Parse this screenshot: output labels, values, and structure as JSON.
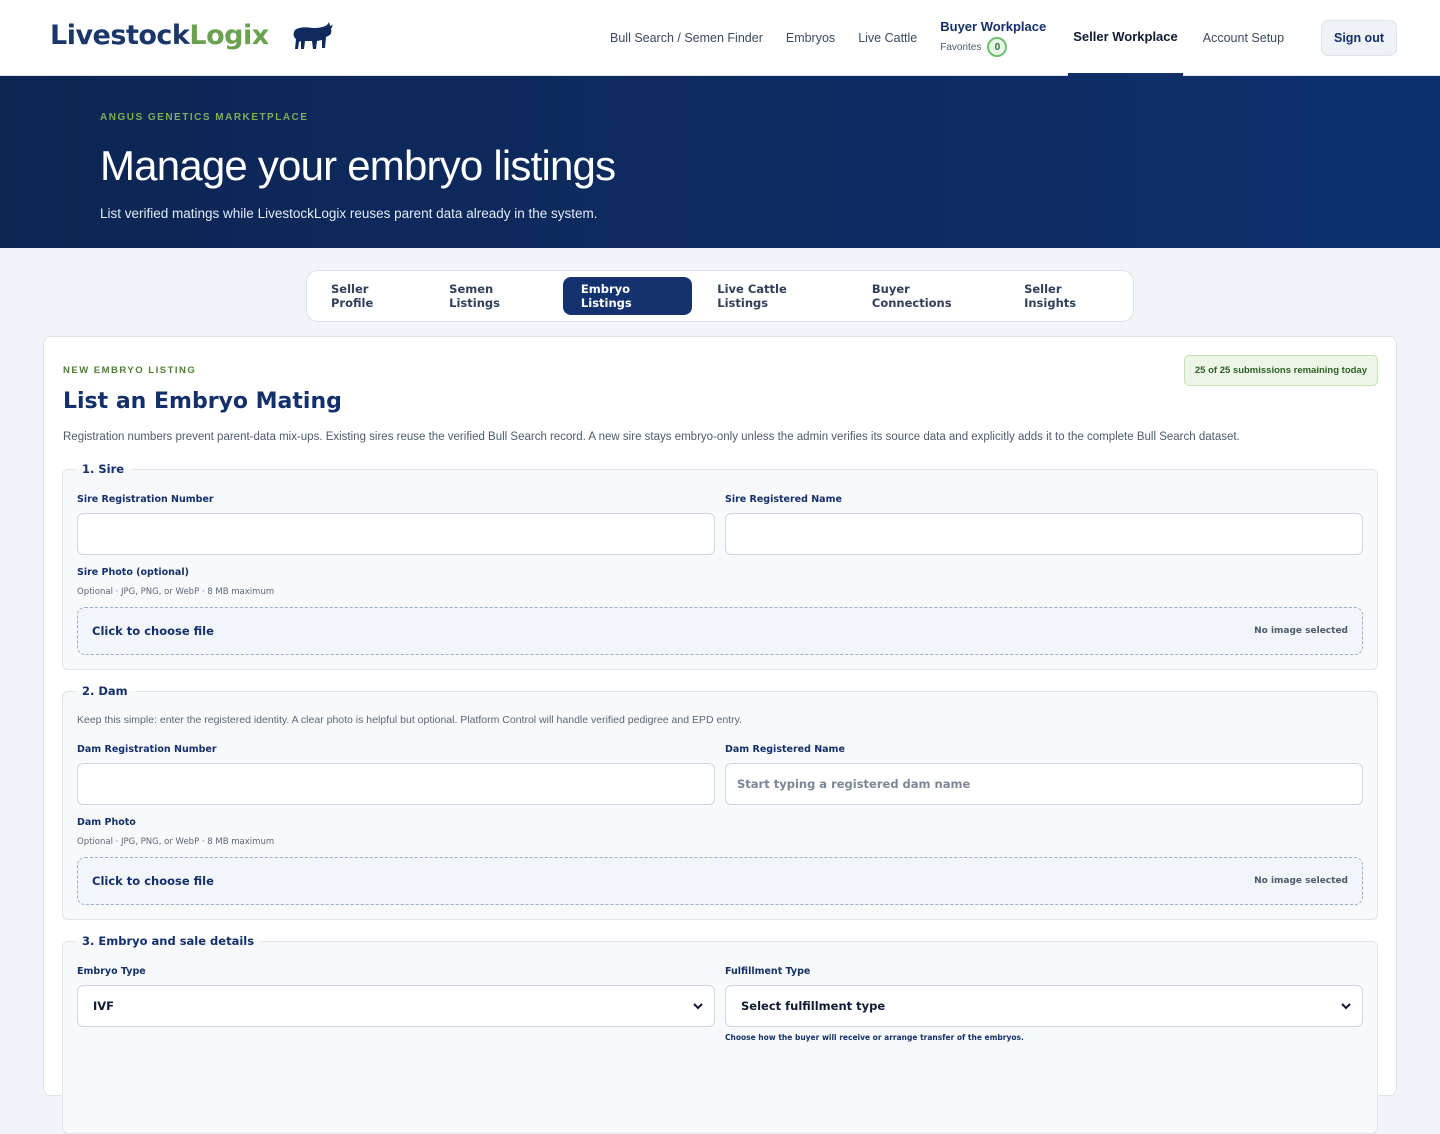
{
  "brand": {
    "name_main": "Livestock",
    "name_accent": "Logix"
  },
  "colors": {
    "navy": "#14306a",
    "accent_green": "#6aa24f",
    "hero_bg": "#0c2553"
  },
  "nav": {
    "items": [
      "Bull Search / Semen Finder",
      "Embryos",
      "Live Cattle"
    ],
    "buyer_workplace": "Buyer Workplace",
    "favorites_label": "Favorites",
    "favorites_count": "0",
    "seller_workplace": "Seller Workplace",
    "account_setup": "Account Setup",
    "sign_out": "Sign out"
  },
  "hero": {
    "kicker": "ANGUS GENETICS MARKETPLACE",
    "title": "Manage your embryo listings",
    "subtitle": "List verified matings while LivestockLogix reuses parent data already in the system."
  },
  "tabs": [
    {
      "label": "Seller Profile",
      "active": false
    },
    {
      "label": "Semen Listings",
      "active": false
    },
    {
      "label": "Embryo Listings",
      "active": true
    },
    {
      "label": "Live Cattle Listings",
      "active": false
    },
    {
      "label": "Buyer Connections",
      "active": false
    },
    {
      "label": "Seller Insights",
      "active": false
    }
  ],
  "form": {
    "kicker": "NEW EMBRYO LISTING",
    "title": "List an Embryo Mating",
    "submissions": "25 of 25 submissions remaining today",
    "intro": "Registration numbers prevent parent-data mix-ups. Existing sires reuse the verified Bull Search record. A new sire stays embryo-only unless the admin verifies its source data and explicitly adds it to the complete Bull Search dataset.",
    "sire": {
      "legend": "1. Sire",
      "reg_label": "Sire Registration Number",
      "reg_value": "",
      "name_label": "Sire Registered Name",
      "name_value": "",
      "photo_label": "Sire Photo (optional)",
      "photo_hint": "Optional · JPG, PNG, or WebP · 8 MB maximum",
      "choose": "Click to choose file",
      "none": "No image selected"
    },
    "dam": {
      "legend": "2. Dam",
      "note": "Keep this simple: enter the registered identity. A clear photo is helpful but optional. Platform Control will handle verified pedigree and EPD entry.",
      "reg_label": "Dam Registration Number",
      "reg_value": "",
      "name_label": "Dam Registered Name",
      "name_placeholder": "Start typing a registered dam name",
      "photo_label": "Dam Photo",
      "photo_hint": "Optional · JPG, PNG, or WebP · 8 MB maximum",
      "choose": "Click to choose file",
      "none": "No image selected"
    },
    "details": {
      "legend": "3. Embryo and sale details",
      "type_label": "Embryo Type",
      "type_value": "IVF",
      "fulfillment_label": "Fulfillment Type",
      "fulfillment_value": "Select fulfillment type",
      "fulfillment_hint": "Choose how the buyer will receive or arrange transfer of the embryos."
    }
  }
}
